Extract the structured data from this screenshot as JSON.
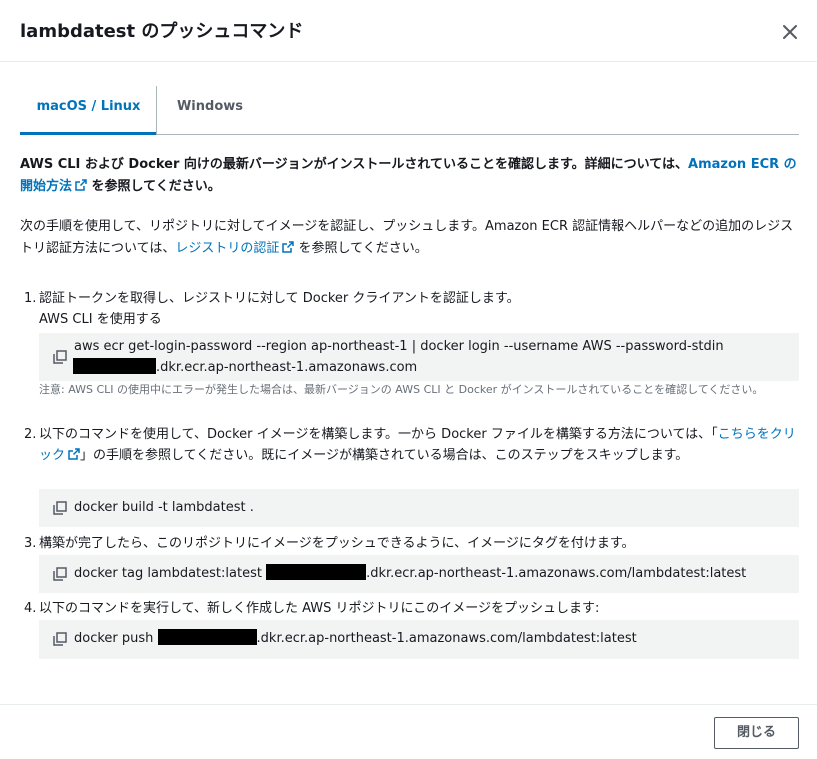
{
  "dialog": {
    "title": "lambdatest のプッシュコマンド",
    "close_icon": "close-icon"
  },
  "tabs": [
    {
      "label": "macOS / Linux",
      "selected": true
    },
    {
      "label": "Windows",
      "selected": false
    }
  ],
  "intro_bold": {
    "text_before": "AWS CLI および Docker 向けの最新バージョンがインストールされていることを確認します。詳細については、",
    "link": "Amazon ECR の開始方法",
    "text_after": " を参照してください。"
  },
  "intro": {
    "text_before": "次の手順を使用して、リポジトリに対してイメージを認証し、プッシュします。Amazon ECR 認証情報ヘルパーなどの追加のレジストリ認証方法については、",
    "link": "レジストリの認証",
    "text_after": " を参照してください。"
  },
  "steps": [
    {
      "num": "1.",
      "text": "認証トークンを取得し、レジストリに対して Docker クライアントを認証します。",
      "subtext": "AWS CLI を使用する",
      "code_line1": "aws ecr get-login-password --region ap-northeast-1 | docker login --username AWS --password-stdin",
      "code_line2_suffix": ".dkr.ecr.ap-northeast-1.amazonaws.com",
      "note": "注意: AWS CLI の使用中にエラーが発生した場合は、最新バージョンの AWS CLI と Docker がインストールされていることを確認してください。"
    },
    {
      "num": "2.",
      "text_before": "以下のコマンドを使用して、Docker イメージを構築します。一から Docker ファイルを構築する方法については、「",
      "link": "こちらをクリック",
      "text_after": "」の手順を参照してください。既にイメージが構築されている場合は、このステップをスキップします。",
      "code": "docker build -t lambdatest ."
    },
    {
      "num": "3.",
      "text": "構築が完了したら、このリポジトリにイメージをプッシュできるように、イメージにタグを付けます。",
      "code_prefix": "docker tag lambdatest:latest ",
      "code_suffix": ".dkr.ecr.ap-northeast-1.amazonaws.com/lambdatest:latest"
    },
    {
      "num": "4.",
      "text": "以下のコマンドを実行して、新しく作成した AWS リポジトリにこのイメージをプッシュします:",
      "code_prefix": "docker push ",
      "code_suffix": ".dkr.ecr.ap-northeast-1.amazonaws.com/lambdatest:latest"
    }
  ],
  "footer": {
    "close_label": "閉じる"
  },
  "colors": {
    "link": "#0073bb",
    "code_bg": "#f2f3f3",
    "text": "#16191f",
    "muted": "#687078"
  }
}
